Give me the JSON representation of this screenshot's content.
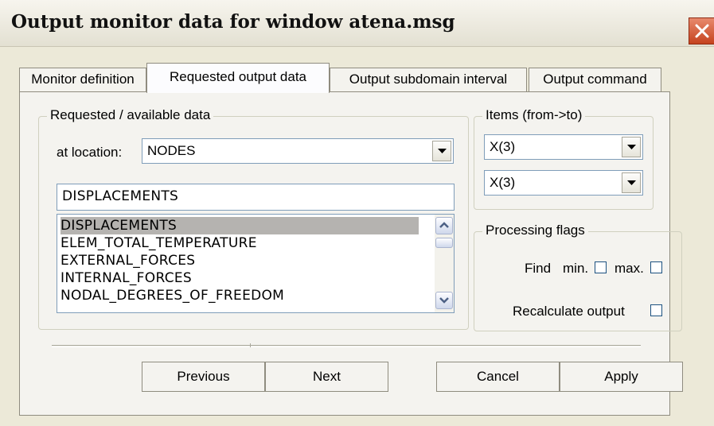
{
  "window": {
    "title": "Output monitor data for window atena.msg"
  },
  "tabs": [
    {
      "label": "Monitor definition"
    },
    {
      "label": "Requested output data",
      "active": true
    },
    {
      "label": "Output subdomain interval"
    },
    {
      "label": "Output command"
    }
  ],
  "requested": {
    "legend": "Requested / available data",
    "location_label": "at location:",
    "location_value": "NODES",
    "data_value": "DISPLACEMENTS",
    "list_items": [
      {
        "label": "DISPLACEMENTS",
        "selected": true
      },
      {
        "label": "ELEM_TOTAL_TEMPERATURE"
      },
      {
        "label": "EXTERNAL_FORCES"
      },
      {
        "label": "INTERNAL_FORCES"
      },
      {
        "label": "NODAL_DEGREES_OF_FREEDOM"
      }
    ]
  },
  "items": {
    "legend": "Items (from->to)",
    "from_value": "X(3)",
    "to_value": "X(3)"
  },
  "flags": {
    "legend": "Processing flags",
    "find_label": "Find",
    "min_label": "min.",
    "max_label": "max.",
    "recalc_label": "Recalculate output",
    "min_checked": false,
    "max_checked": false,
    "recalc_checked": false
  },
  "buttons": {
    "previous": "Previous",
    "next": "Next",
    "cancel": "Cancel",
    "apply": "Apply"
  },
  "colors": {
    "close_button": "#c5421e",
    "selection": "#b5b3b0",
    "field_border": "#7f9db9"
  },
  "icons": {
    "close": "close-icon",
    "dropdown": "chevron-down-icon",
    "scroll_up": "chevron-up-icon",
    "scroll_down": "chevron-down-icon"
  }
}
